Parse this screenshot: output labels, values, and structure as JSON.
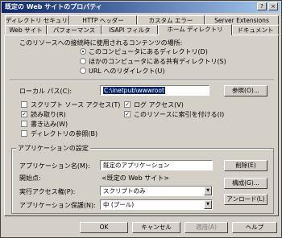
{
  "window": {
    "title": "既定の Web サイトのプロパティ",
    "help_glyph": "?",
    "close_glyph": "×"
  },
  "tabs": {
    "row1": [
      "ディレクトリ セキュリティ",
      "HTTP ヘッダー",
      "カスタム エラー",
      "Server Extensions"
    ],
    "row2": [
      "Web サイト",
      "パフォーマンス",
      "ISAPI フィルタ",
      "ホーム ディレクトリ",
      "ドキュメント"
    ],
    "active": "ホーム ディレクトリ"
  },
  "content_source": {
    "prompt": "このリソースへの接続時に使用されるコンテンツの場所:",
    "options": [
      {
        "label": "このコンピュータにあるディレクトリ(D)",
        "selected": true
      },
      {
        "label": "ほかのコンピュータにある共有ディレクトリ(S)",
        "selected": false
      },
      {
        "label": "URL へのリダイレクト(U)",
        "selected": false
      }
    ]
  },
  "local_path": {
    "label": "ローカル パス(C):",
    "value": "C:\\inetpub\\wwwroot",
    "browse_label": "参照(O)..."
  },
  "permissions": {
    "left": [
      {
        "label": "スクリプト ソース アクセス(T)",
        "checked": false
      },
      {
        "label": "読み取り(R)",
        "checked": true
      },
      {
        "label": "書き込み(W)",
        "checked": false
      },
      {
        "label": "ディレクトリの参照(B)",
        "checked": false
      }
    ],
    "right": [
      {
        "label": "ログ アクセス(V)",
        "checked": true
      },
      {
        "label": "このリソースに索引を付ける(I)",
        "checked": true
      }
    ],
    "check_glyph": "✓"
  },
  "app_settings": {
    "section_label": "アプリケーションの設定",
    "app_name_label": "アプリケーション名(M):",
    "app_name_value": "既定のアプリケーション",
    "remove_label": "削除(E)",
    "start_point_label": "開始点:",
    "start_point_value": "<既定の Web サイト>",
    "config_label": "構成(G)...",
    "exec_perm_label": "実行アクセス権(P):",
    "exec_perm_value": "スクリプトのみ",
    "unload_label": "アンロード(L)",
    "protection_label": "アプリケーション保護(N):",
    "protection_value": "中 (プール)",
    "dropdown_glyph": "▼"
  },
  "footer": {
    "ok": "OK",
    "cancel": "キャンセル",
    "apply": "適用(A)",
    "help": "ヘルプ"
  }
}
